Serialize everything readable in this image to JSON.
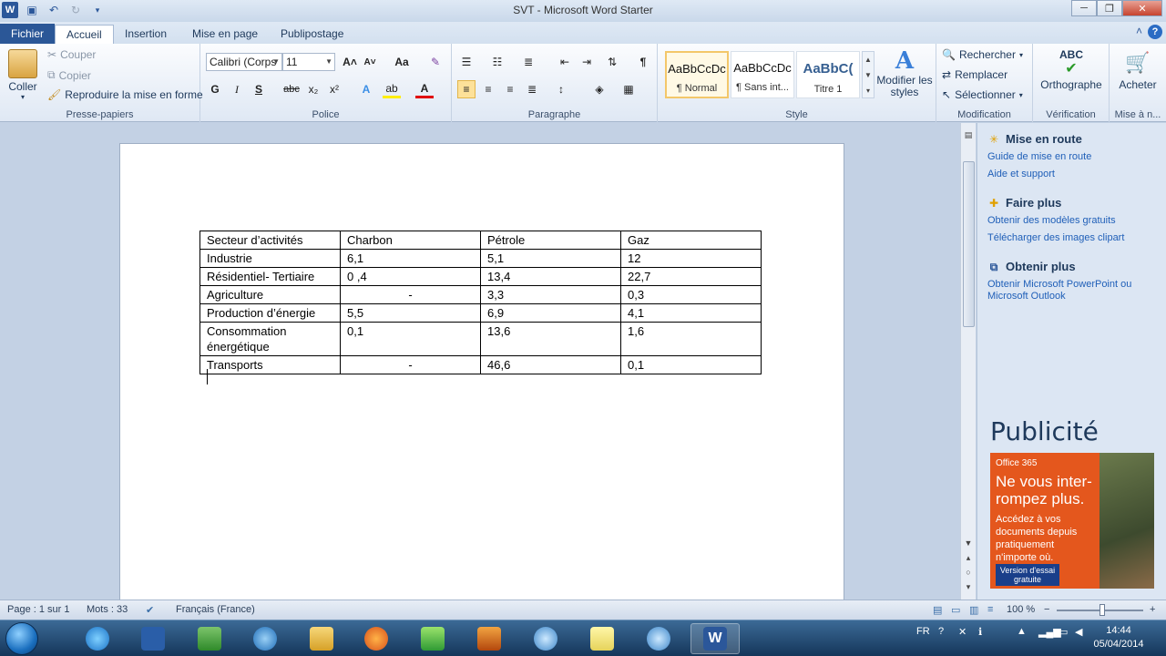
{
  "window": {
    "title": "SVT  -  Microsoft Word Starter",
    "minimize_glyph": "─",
    "restore_glyph": "❐",
    "close_glyph": "✕"
  },
  "tabs": [
    "Fichier",
    "Accueil",
    "Insertion",
    "Mise en page",
    "Publipostage"
  ],
  "ribbon": {
    "clipboard": {
      "paste": "Coller",
      "cut": "Couper",
      "copy": "Copier",
      "format_painter": "Reproduire la mise en forme",
      "label": "Presse-papiers"
    },
    "font": {
      "font_name": "Calibri (Corps",
      "font_size": "11",
      "bold": "G",
      "italic": "I",
      "underline": "S",
      "strike": "abc",
      "subscript": "x₂",
      "superscript": "x²",
      "grow": "A˄",
      "shrink": "A˅",
      "case": "Aa",
      "label": "Police"
    },
    "paragraph": {
      "pilcrow": "¶",
      "label": "Paragraphe"
    },
    "styles": {
      "items": [
        {
          "preview": "AaBbCcDc",
          "name": "¶ Normal"
        },
        {
          "preview": "AaBbCcDc",
          "name": "¶ Sans int..."
        },
        {
          "preview": "AaBbC(",
          "name": "Titre 1"
        }
      ],
      "change_styles": "Modifier les styles",
      "label": "Style"
    },
    "editing": {
      "find": "Rechercher",
      "replace": "Remplacer",
      "select": "Sélectionner",
      "label": "Modification"
    },
    "proofing": {
      "spelling": "Orthographe",
      "spelling_icon_text": "ABC",
      "label": "Vérification"
    },
    "buy": {
      "buy": "Acheter",
      "label": "Mise à n..."
    }
  },
  "document": {
    "table": [
      [
        "Secteur d’activités",
        "Charbon",
        "Pétrole",
        "Gaz"
      ],
      [
        "Industrie",
        "6,1",
        "5,1",
        "12"
      ],
      [
        "Résidentiel- Tertiaire",
        "0 ,4",
        "13,4",
        "22,7"
      ],
      [
        "Agriculture",
        "-",
        "3,3",
        "0,3"
      ],
      [
        "Production d’énergie",
        "5,5",
        "6,9",
        "4,1"
      ],
      [
        "Consommation énergétique",
        "0,1",
        "13,6",
        "1,6"
      ],
      [
        "Transports",
        "-",
        "46,6",
        "0,1"
      ]
    ]
  },
  "taskpane": {
    "getting_started": {
      "title": "Mise en route",
      "links": [
        "Guide de mise en route",
        "Aide et support"
      ]
    },
    "do_more": {
      "title": "Faire plus",
      "links": [
        "Obtenir des modèles gratuits",
        "Télécharger des images clipart"
      ]
    },
    "get_more": {
      "title": "Obtenir plus",
      "links": [
        "Obtenir Microsoft PowerPoint ou Microsoft Outlook"
      ]
    },
    "ad_label": "Publicité",
    "ad": {
      "brand": "Office 365",
      "headline": "Ne vous inter- rompez plus.",
      "body": "Accédez à vos documents depuis pratiquement n'importe où.",
      "cta": "Version d'essai gratuite"
    }
  },
  "status": {
    "page": "Page : 1 sur 1",
    "words": "Mots : 33",
    "language": "Français (France)",
    "zoom": "100 %",
    "zoom_minus": "−",
    "zoom_plus": "+"
  },
  "taskbar": {
    "lang": "FR",
    "time": "14:44",
    "date": "05/04/2014"
  },
  "colors": {
    "accent": "#2b579a",
    "ad_orange": "#e4571d"
  }
}
